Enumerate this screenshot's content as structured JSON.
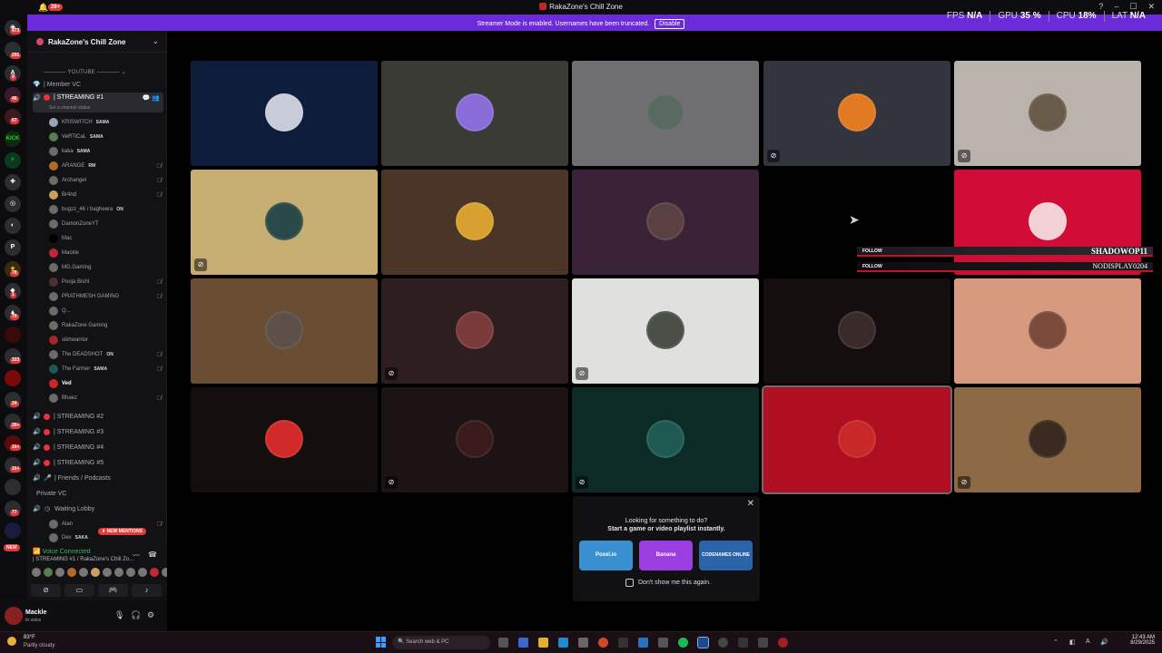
{
  "titlebar": {
    "title": "RakaZone's Chill Zone",
    "notif_count": "26+"
  },
  "banner": {
    "text": "Streamer Mode is enabled. Usernames have been truncated.",
    "button": "Disable"
  },
  "perf": {
    "fps_label": "FPS",
    "fps_value": "N/A",
    "gpu_label": "GPU",
    "gpu_value": "35",
    "cpu_label": "CPU",
    "cpu_value": "18",
    "lat_label": "LAT",
    "lat_value": "N/A"
  },
  "rail": {
    "badges": [
      "473",
      "291",
      "9",
      "46",
      "67",
      "78",
      "1",
      "70",
      "323",
      "24",
      "26+",
      "1k+",
      "1k+",
      "77"
    ],
    "new_label": "NEW"
  },
  "sidebar": {
    "server_name": "RakaZone's Chill Zone",
    "category": "YOUTUBE",
    "member_vc": "| Member VC",
    "active_channel": "| STREAMING #1",
    "channel_status": "Set a channel status",
    "users": [
      {
        "name": "KRISWITCH",
        "tag": "SAMA"
      },
      {
        "name": "VeRTiCaL",
        "tag": "SAMA"
      },
      {
        "name": "kaka",
        "tag": "SAMA"
      },
      {
        "name": "ARANGE",
        "tag": "RM"
      },
      {
        "name": "Archangel",
        "tag": ""
      },
      {
        "name": "Br4nd",
        "tag": ""
      },
      {
        "name": "bugzz_46 / bagheera",
        "tag": "ON"
      },
      {
        "name": "DamonZoneYT",
        "tag": ""
      },
      {
        "name": "Mac",
        "tag": ""
      },
      {
        "name": "Mackle",
        "tag": ""
      },
      {
        "name": "MG.Gaming",
        "tag": ""
      },
      {
        "name": "Pooja Bisht",
        "tag": ""
      },
      {
        "name": "PRATHMESH GAMING",
        "tag": ""
      },
      {
        "name": "Q...",
        "tag": ""
      },
      {
        "name": "RakaZone Gaming",
        "tag": ""
      },
      {
        "name": "sikhwarrior",
        "tag": ""
      },
      {
        "name": "The DEADSHOT",
        "tag": "ON"
      },
      {
        "name": "The Farmer",
        "tag": "SAMA"
      },
      {
        "name": "Ved",
        "tag": ""
      },
      {
        "name": "Bhaez",
        "tag": ""
      }
    ],
    "channels": [
      "| STREAMING #2",
      "| STREAMING #3",
      "| STREAMING #4",
      "| STREAMING #5",
      "| Friends / Podcasts"
    ],
    "private_vc": "Private VC",
    "waiting_lobby": "Waiting Lobby",
    "lobby_users": [
      {
        "name": "Alan",
        "tag": ""
      },
      {
        "name": "Dev",
        "tag": "SAKA"
      }
    ],
    "new_mentions": "NEW MENTIONS"
  },
  "voice": {
    "title": "Voice Connected",
    "channel": "| STREAMING #1 / RakaZone's Chill Zo..."
  },
  "userpanel": {
    "name": "Mackle",
    "status": "In voice"
  },
  "tiles": [
    {
      "color": "#0f1d3d",
      "avatar": "#c8ccd8",
      "muted": false
    },
    {
      "color": "#393b34",
      "avatar": "#8a6cd8",
      "muted": false
    },
    {
      "color": "#6f6f72",
      "avatar": "#5a6a62",
      "muted": false
    },
    {
      "color": "#32343e",
      "avatar": "#e07b22",
      "muted": true
    },
    {
      "color": "#b9b3ac",
      "avatar": "#6a5a4a",
      "muted": true
    },
    {
      "color": "#c6ad72",
      "avatar": "#2a4a4a",
      "muted": true
    },
    {
      "color": "#4a3527",
      "avatar": "#d8a030",
      "muted": false
    },
    {
      "color": "#3a2337",
      "avatar": "#5a4040",
      "muted": false
    },
    {
      "color": "#000000",
      "avatar": "#000000",
      "muted": false
    },
    {
      "color": "#d10d37",
      "avatar": "#f2d0d6",
      "muted": false
    },
    {
      "color": "#6a4e33",
      "avatar": "#5c5048",
      "muted": false
    },
    {
      "color": "#2e1e1f",
      "avatar": "#7a3a3a",
      "muted": true
    },
    {
      "color": "#e0e0de",
      "avatar": "#4a5048",
      "muted": true
    },
    {
      "color": "#140f0e",
      "avatar": "#3a2a2a",
      "muted": false
    },
    {
      "color": "#d89a7e",
      "avatar": "#7a4a3a",
      "muted": false
    },
    {
      "color": "#140e0e",
      "avatar": "#d02a2a",
      "muted": false
    },
    {
      "color": "#1c1414",
      "avatar": "#3a1a1a",
      "muted": true
    },
    {
      "color": "#0c2b26",
      "avatar": "#1f5a52",
      "muted": true
    },
    {
      "color": "#b00f21",
      "avatar": "#c82828",
      "muted": false
    },
    {
      "color": "#8d6a45",
      "avatar": "#3a2a20",
      "muted": true
    }
  ],
  "follow": [
    {
      "label": "FOLLOW",
      "name": "SHADOWOP11"
    },
    {
      "label": "FOLLOW",
      "name": "NODISPLAY0204"
    }
  ],
  "activity": {
    "line1": "Looking for something to do?",
    "line2": "Start a game or video playlist instantly.",
    "games": [
      {
        "name": "Poxel.io",
        "color": "#3a8fd0"
      },
      {
        "name": "Banana",
        "color": "#9b3ee0"
      },
      {
        "name": "CODENAMES ONLINE",
        "color": "#2a64a8"
      }
    ],
    "checkbox_label": "Don't show me this again."
  },
  "taskbar": {
    "temp": "83°F",
    "weather": "Partly cloudy",
    "search_placeholder": "Search web & PC",
    "time": "12:43 AM",
    "date": "8/29/2025"
  },
  "colors": {
    "accent": "#6c2bd9",
    "voice_green": "#43b26b",
    "badge_red": "#e23a3a"
  }
}
